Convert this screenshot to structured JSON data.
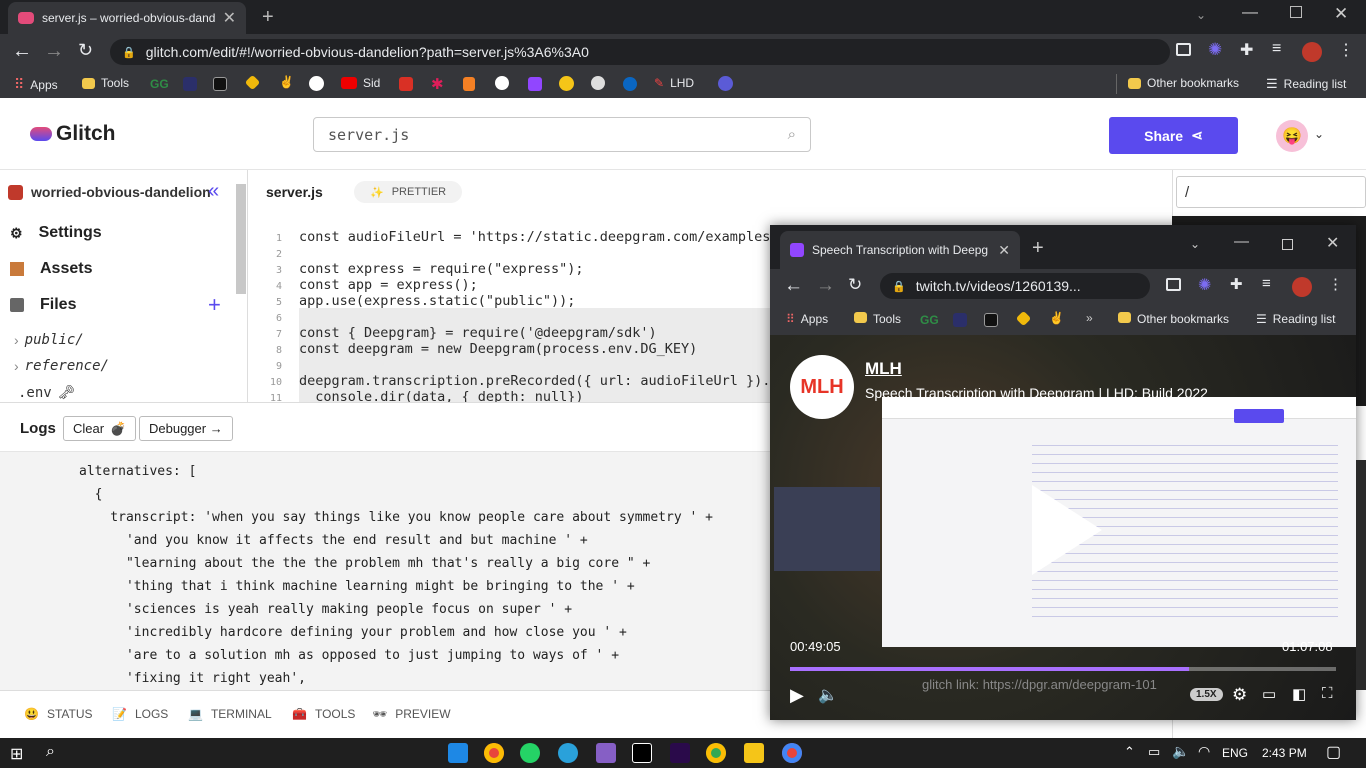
{
  "browser": {
    "tab_title": "server.js – worried-obvious-dandelion",
    "url": "glitch.com/edit/#!/worried-obvious-dandelion?path=server.js%3A6%3A0",
    "bookmarks": [
      "Apps",
      "Tools",
      "Sid",
      "LHD"
    ],
    "other_bookmarks": "Other bookmarks",
    "reading_list": "Reading list"
  },
  "glitch": {
    "logo": "Glitch",
    "search": "server.js",
    "share": "Share",
    "project": "worried-obvious-dandelion",
    "nav": [
      "Settings",
      "Assets",
      "Files"
    ],
    "tree": [
      "public/",
      "reference/",
      ".env"
    ],
    "file_tab": "server.js",
    "prettier": "PRETTIER",
    "preview_url": "/"
  },
  "code": {
    "lines": [
      {
        "n": "1",
        "text": "const audioFileUrl = 'https://static.deepgram.com/examples/"
      },
      {
        "n": "2",
        "text": ""
      },
      {
        "n": "3",
        "text": "const express = require(\"express\");"
      },
      {
        "n": "4",
        "text": "const app = express();"
      },
      {
        "n": "5",
        "text": "app.use(express.static(\"public\"));"
      },
      {
        "n": "6",
        "text": ""
      },
      {
        "n": "7",
        "text": "const { Deepgram} = require('@deepgram/sdk')"
      },
      {
        "n": "8",
        "text": "const deepgram = new Deepgram(process.env.DG_KEY)"
      },
      {
        "n": "9",
        "text": ""
      },
      {
        "n": "10",
        "text": "deepgram.transcription.preRecorded({ url: audioFileUrl }).t"
      },
      {
        "n": "11",
        "text": "  console.dir(data, { depth: null})"
      }
    ]
  },
  "logs": {
    "title": "Logs",
    "clear": "Clear",
    "debugger": "Debugger →",
    "lines": [
      "alternatives: [",
      "  {",
      "    transcript: 'when you say things like you know people care about symmetry ' +",
      "      'and you know it affects the end result and but machine ' +",
      "      \"learning about the the the problem mh that's really a big core \" +",
      "      'thing that i think machine learning might be bringing to the ' +",
      "      'sciences is yeah really making people focus on super ' +",
      "      'incredibly hardcore defining your problem and how close you ' +",
      "      'are to a solution mh as opposed to just jumping to ways of ' +",
      "      'fixing it right yeah',"
    ]
  },
  "bottom_bar": [
    "STATUS",
    "LOGS",
    "TERMINAL",
    "TOOLS",
    "PREVIEW"
  ],
  "popup": {
    "tab_title": "Speech Transcription with Deepg",
    "url": "twitch.tv/videos/1260139...",
    "bookmarks": [
      "Apps",
      "Tools"
    ],
    "other_bookmarks": "Other bookmarks",
    "reading_list": "Reading list",
    "channel": "MLH",
    "video_title": "Speech Transcription with Deepgram | LHD: Build 2022",
    "time_current": "00:49:05",
    "time_total": "01:07:08",
    "progress": 0.73,
    "speed": "1.5X",
    "overlay_text": "glitch link: https://dpgr.am/deepgram-101"
  },
  "taskbar": {
    "lang": "ENG",
    "time": "2:43 PM"
  }
}
